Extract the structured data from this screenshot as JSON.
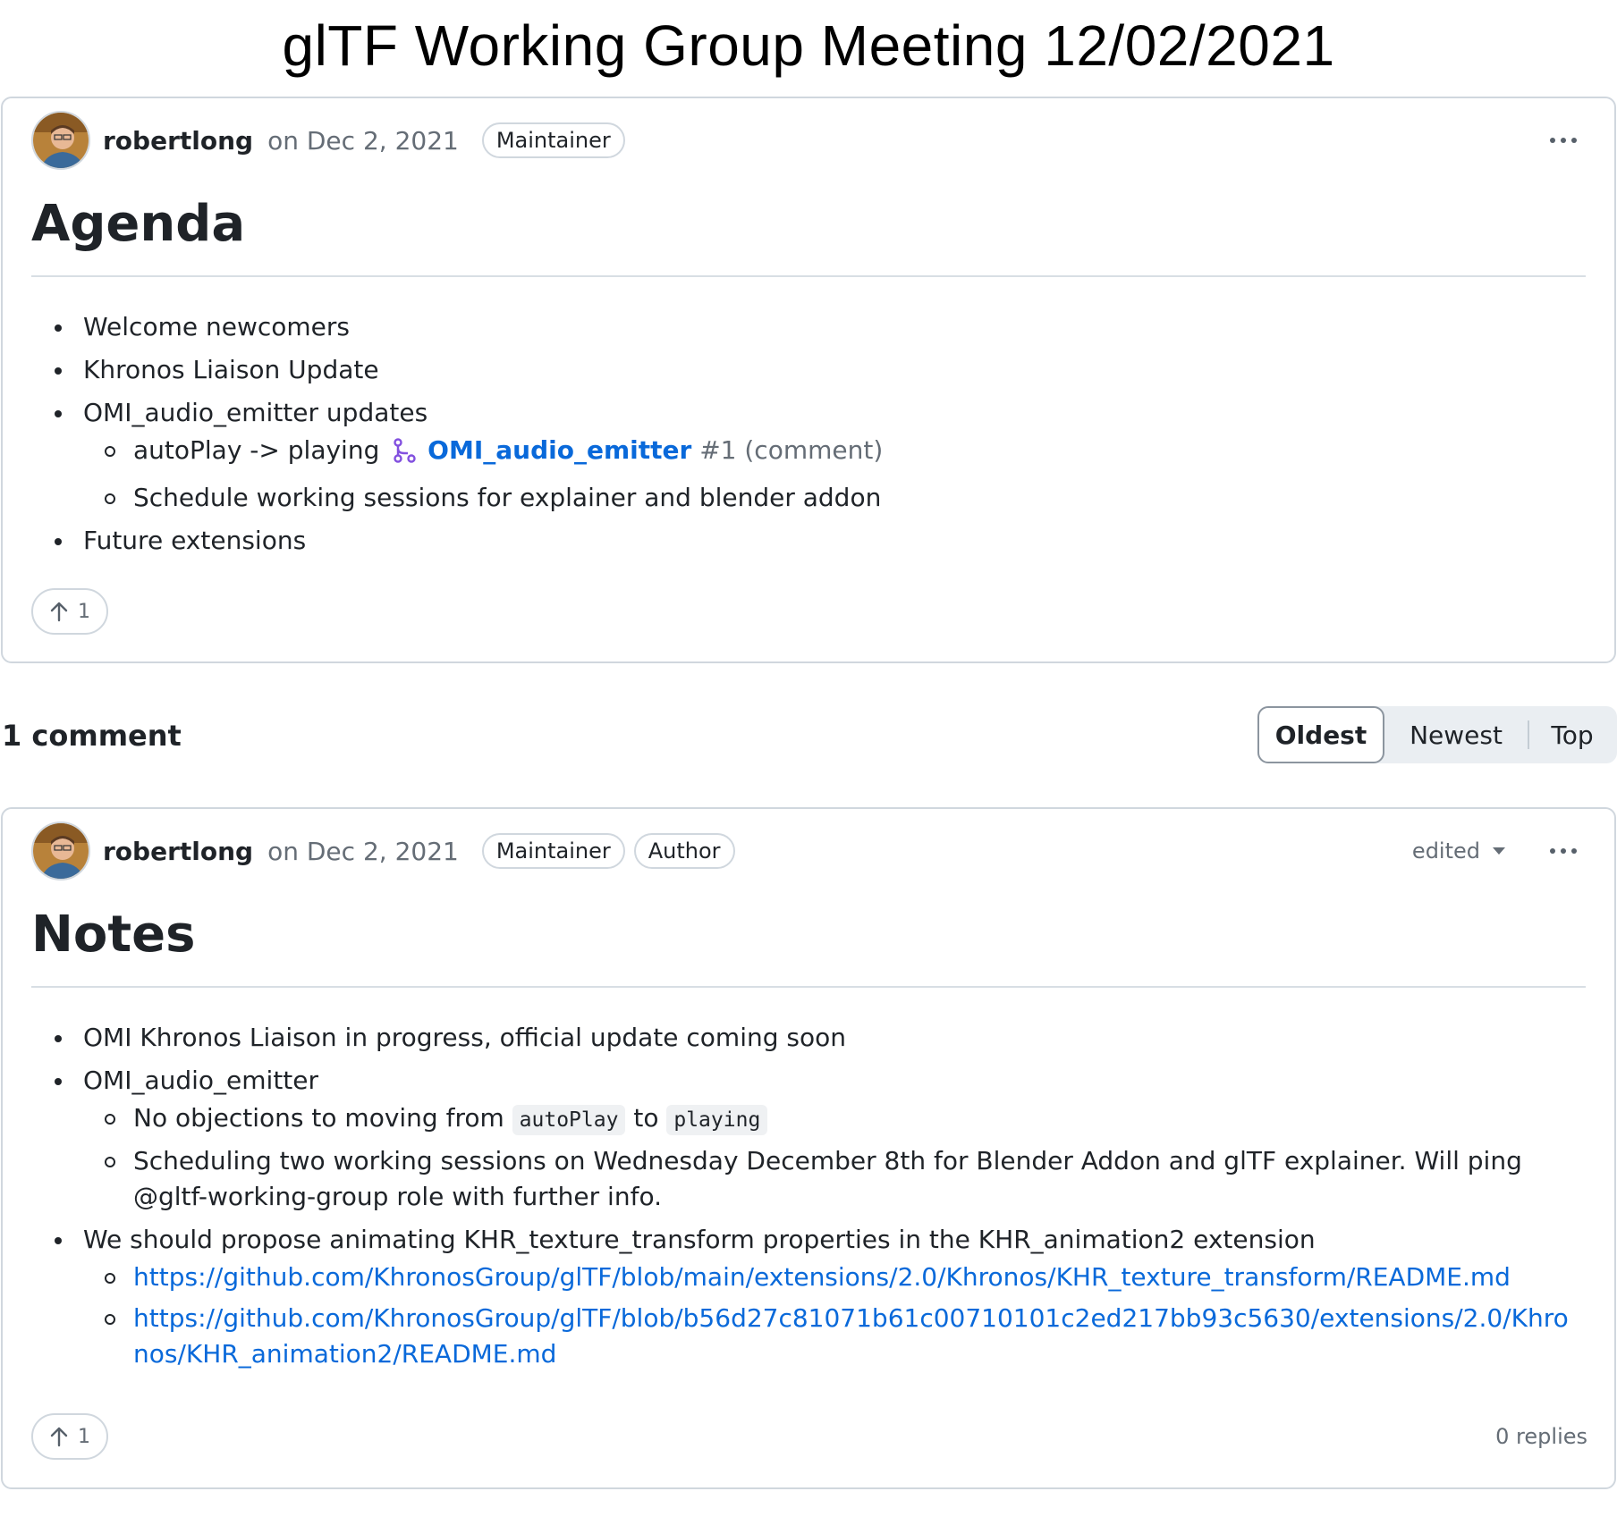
{
  "page_title": "glTF Working Group Meeting 12/02/2021",
  "post": {
    "username": "robertlong",
    "timestamp": "on Dec 2, 2021",
    "badges": [
      "Maintainer"
    ],
    "heading": "Agenda",
    "items": {
      "i0": "Welcome newcomers",
      "i1": "Khronos Liaison Update",
      "i2": "OMI_audio_emitter updates",
      "i2_sub0_text": "autoPlay -> playing",
      "i2_sub0_ref_title": "OMI_audio_emitter",
      "i2_sub0_ref_num": "#1 (comment)",
      "i2_sub1": "Schedule working sessions for explainer and blender addon",
      "i3": "Future extensions"
    },
    "upvotes": "1",
    "colors": {
      "link": "#0969da",
      "pr_icon": "#8250df"
    }
  },
  "comments_bar": {
    "count_label": "1 comment",
    "sort": {
      "oldest": "Oldest",
      "newest": "Newest",
      "top": "Top",
      "selected": "Oldest"
    }
  },
  "comment": {
    "username": "robertlong",
    "timestamp": "on Dec 2, 2021",
    "badges": [
      "Maintainer",
      "Author"
    ],
    "edited_label": "edited",
    "heading": "Notes",
    "items": {
      "i0": "OMI Khronos Liaison in progress, official update coming soon",
      "i1": "OMI_audio_emitter",
      "i1_sub0_pre": "No objections to moving from",
      "i1_sub0_code1": "autoPlay",
      "i1_sub0_mid": "to",
      "i1_sub0_code2": "playing",
      "i1_sub1": "Scheduling two working sessions on Wednesday December 8th for Blender Addon and glTF explainer. Will ping @gltf-working-group role with further info.",
      "i2": "We should propose animating KHR_texture_transform properties in the KHR_animation2 extension",
      "i2_link0": "https://github.com/KhronosGroup/glTF/blob/main/extensions/2.0/Khronos/KHR_texture_transform/README.md",
      "i2_link1": "https://github.com/KhronosGroup/glTF/blob/b56d27c81071b61c00710101c2ed217bb93c5630/extensions/2.0/Khronos/KHR_animation2/README.md"
    },
    "upvotes": "1",
    "replies": "0 replies"
  },
  "icons": {
    "avatar": "avatar",
    "more": "kebab-menu-icon",
    "upvote": "arrow-up-icon",
    "pr": "git-pull-request-icon",
    "dropdown": "caret-down-icon"
  }
}
